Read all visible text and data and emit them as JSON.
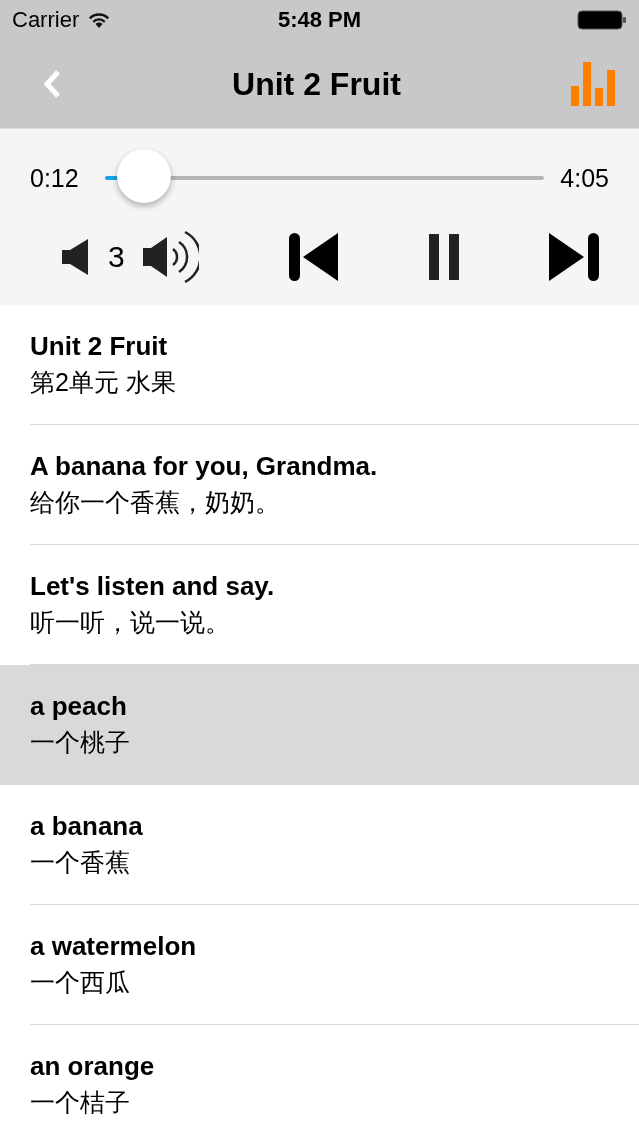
{
  "status_bar": {
    "carrier": "Carrier",
    "time": "5:48 PM"
  },
  "nav": {
    "title": "Unit 2 Fruit"
  },
  "player": {
    "elapsed": "0:12",
    "duration": "4:05",
    "progress": {
      "level": 0.05
    },
    "volume": "3",
    "playing": true
  },
  "items": [
    {
      "english": "Unit 2 Fruit",
      "chinese": "第2单元 水果",
      "selected": false
    },
    {
      "english": "A banana for you, Grandma.",
      "chinese": "给你一个香蕉，奶奶。",
      "selected": false
    },
    {
      "english": "Let's listen and say.",
      "chinese": "听一听，说一说。",
      "selected": false
    },
    {
      "english": "a peach",
      "chinese": "一个桃子",
      "selected": true
    },
    {
      "english": "a banana",
      "chinese": "一个香蕉",
      "selected": false
    },
    {
      "english": "a watermelon",
      "chinese": "一个西瓜",
      "selected": false
    },
    {
      "english": "an orange",
      "chinese": "一个桔子",
      "selected": false
    }
  ]
}
